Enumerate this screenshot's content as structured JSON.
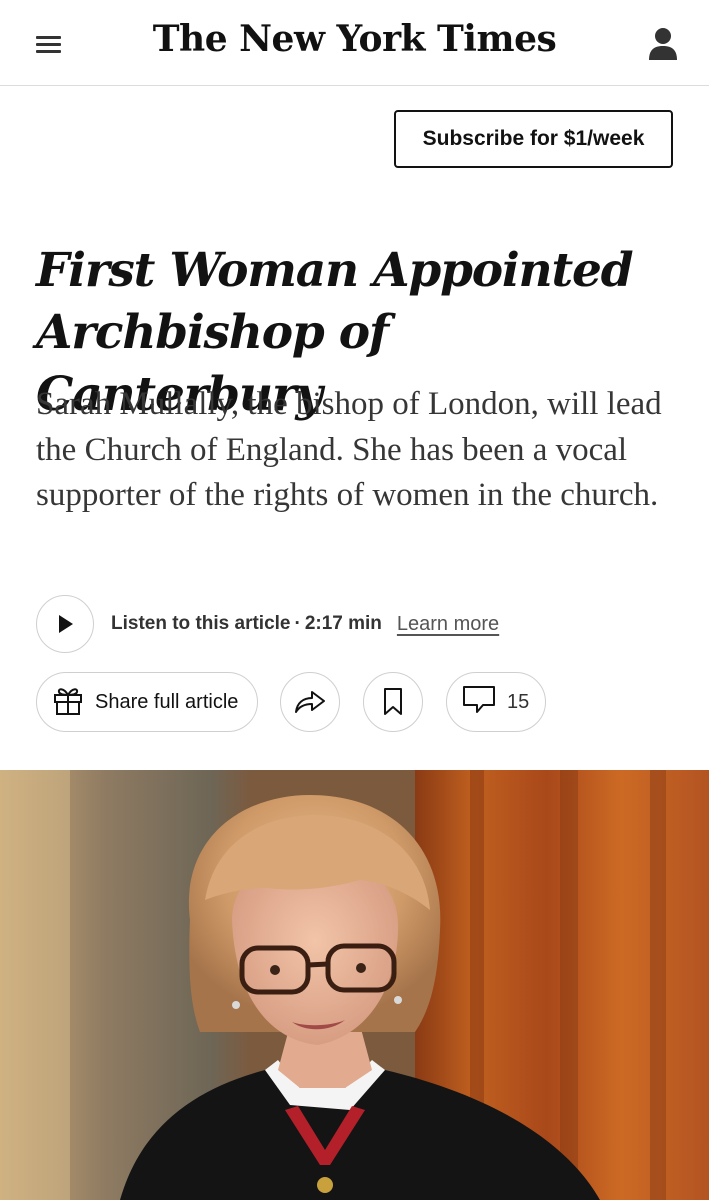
{
  "header": {
    "logo": "The New York Times",
    "menu_icon": "hamburger-menu-icon",
    "account_icon": "person-icon"
  },
  "subscribe": {
    "label": "Subscribe for $1/week"
  },
  "article": {
    "headline": "First Woman Appointed Archbishop of Canterbury",
    "summary": "Sarah Mullally, the bishop of London, will lead the Church of England. She has been a vocal supporter of the rights of women in the church."
  },
  "audio": {
    "play_icon": "play-icon",
    "listen_label": "Listen to this article",
    "separator": "·",
    "duration": "2:17 min",
    "learn_more": "Learn more"
  },
  "actions": {
    "share_full_label": "Share full article",
    "gift_icon": "gift-icon",
    "share_icon": "share-arrow-icon",
    "save_icon": "bookmark-icon",
    "comments_icon": "comment-icon",
    "comments_count": "15"
  },
  "colors": {
    "text": "#121212",
    "summary_text": "#363636",
    "border": "#cfcfcf",
    "photo_curtain": "#b5531f"
  }
}
